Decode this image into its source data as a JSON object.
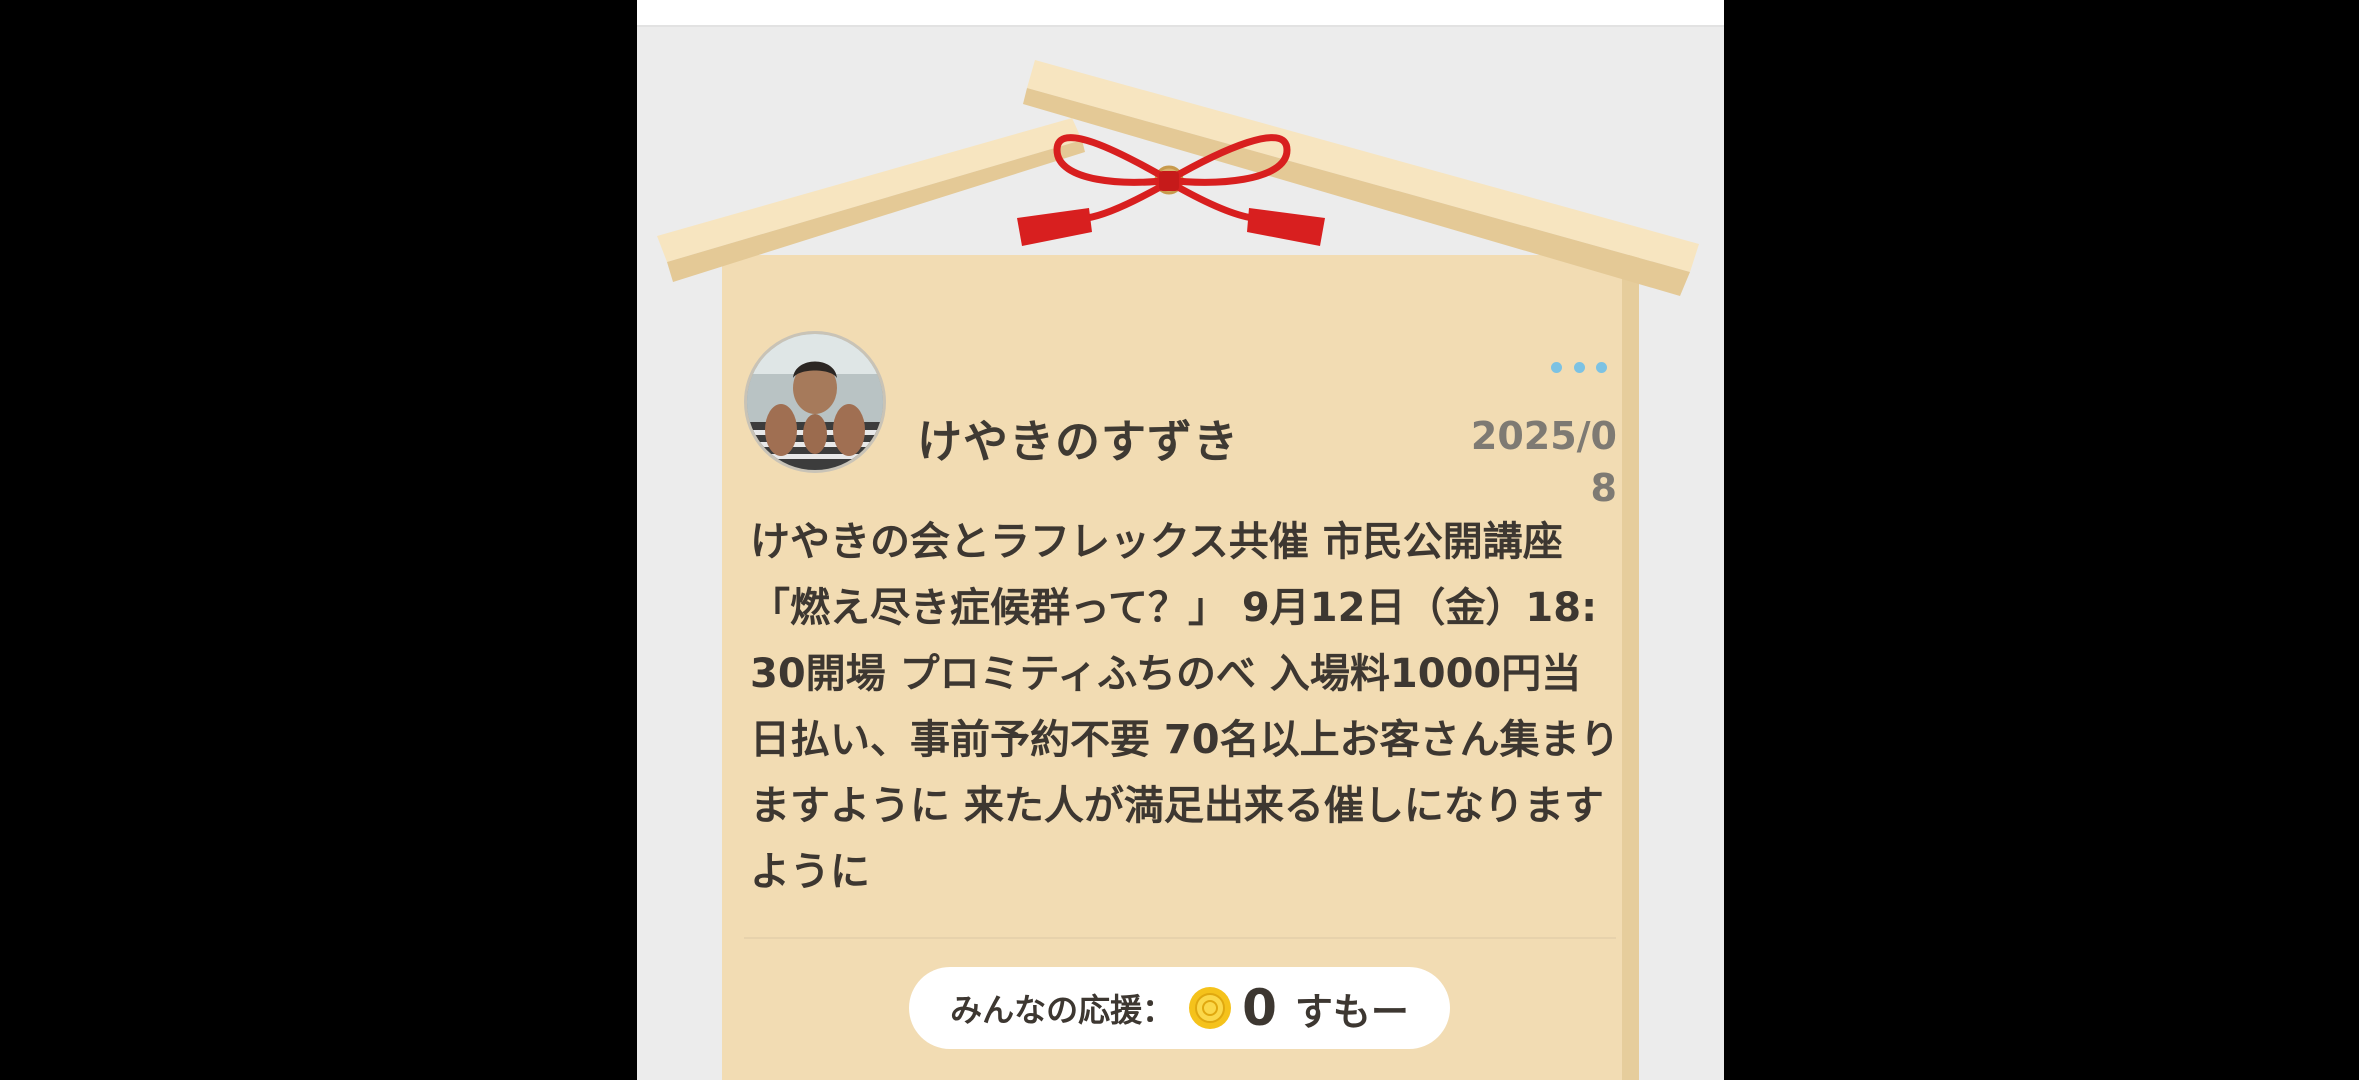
{
  "post": {
    "username": "けやきのすずき",
    "date": "2025/08",
    "body": "けやきの会とラフレックス共催 市民公開講座「燃え尽き症候群って？」 9月12日（金）18:30開場 プロミティふちのべ 入場料1000円当日払い、事前予約不要 70名以上お客さん集まりますように 来た人が満足出来る催しになりますように"
  },
  "support": {
    "label": "みんなの応援：",
    "count": "0",
    "unit": "すもー"
  },
  "icons": {
    "avatar": "user-avatar-photo",
    "menu": "more-dots-icon",
    "coin": "coin-icon",
    "ribbon": "red-ribbon-bow"
  },
  "colors": {
    "board": "#f2dcb3",
    "roof": "#f6e3bb",
    "ribbon": "#d81f1f",
    "dots": "#7cc2e3",
    "background": "#ececec",
    "coin": "#f5c21b"
  }
}
